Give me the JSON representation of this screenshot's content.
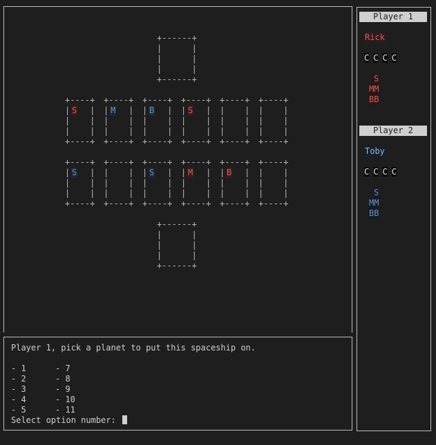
{
  "board": {
    "top_pile": "+------+\n|      |\n|      |\n|      |\n+------+",
    "bottom_pile": "+------+\n|      |\n|      |\n|      |\n+------+",
    "card_art": "+----+\n|    |\n|    |\n|    |\n+----+",
    "row1": [
      {
        "ship": "S",
        "owner": "red"
      },
      {
        "ship": "M",
        "owner": "blue"
      },
      {
        "ship": "B",
        "owner": "blue"
      },
      {
        "ship": "S",
        "owner": "red"
      },
      {
        "ship": "",
        "owner": ""
      },
      {
        "ship": "",
        "owner": ""
      }
    ],
    "row2": [
      {
        "ship": "S",
        "owner": "blue"
      },
      {
        "ship": "",
        "owner": ""
      },
      {
        "ship": "S",
        "owner": "blue"
      },
      {
        "ship": "M",
        "owner": "red"
      },
      {
        "ship": "B",
        "owner": "red"
      },
      {
        "ship": "",
        "owner": ""
      }
    ]
  },
  "players": [
    {
      "header": "Player 1",
      "name": "Rick",
      "coins": [
        "C",
        "C",
        "C",
        "C"
      ],
      "ships": [
        "S",
        "MM",
        "BB"
      ],
      "color": "#d45f5f"
    },
    {
      "header": "Player 2",
      "name": "Toby",
      "coins": [
        "C",
        "C",
        "C",
        "C"
      ],
      "ships": [
        "S",
        "MM",
        "BB"
      ],
      "color": "#6f8fb8"
    }
  ],
  "prompt": {
    "question": "Player 1, pick a planet to put this spaceship on.",
    "options_left": [
      "- 1",
      "- 2",
      "- 3",
      "- 4",
      "- 5"
    ],
    "options_right": [
      "- 7",
      "- 8",
      "- 9",
      "- 10",
      "- 11"
    ],
    "input_label": "Select option number: "
  }
}
